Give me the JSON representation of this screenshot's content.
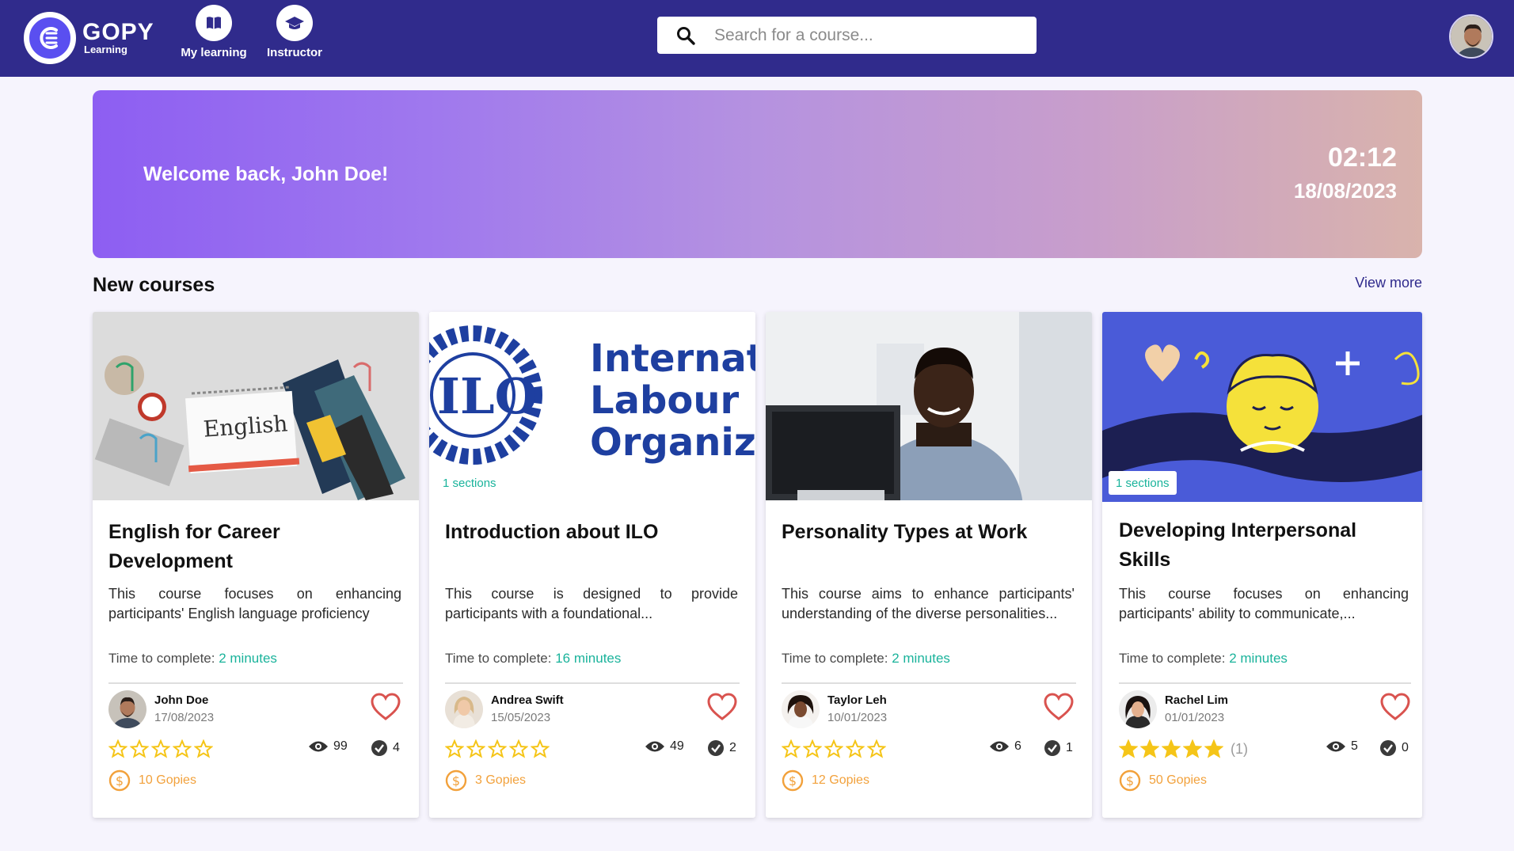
{
  "header": {
    "logo": {
      "brand": "GOPY",
      "sub": "Learning"
    },
    "nav": [
      {
        "label": "My learning",
        "icon": "book-icon"
      },
      {
        "label": "Instructor",
        "icon": "graduation-cap-icon"
      }
    ],
    "search": {
      "placeholder": "Search for a course...",
      "value": ""
    },
    "avatar": "user-avatar"
  },
  "banner": {
    "welcome": "Welcome back, John Doe!",
    "time": "02:12",
    "date": "18/08/2023"
  },
  "section": {
    "title": "New courses",
    "view_more": "View more"
  },
  "colors": {
    "topbar": "#302b8c",
    "accent_green": "#1ab39b",
    "star": "#f5c518",
    "heart": "#d9534f",
    "coin": "#f2a13b"
  },
  "courses": [
    {
      "title": "English for Career Development",
      "description": "This course focuses on enhancing participants' English language proficiency",
      "time_label": "Time to complete:",
      "time_value": "2 minutes",
      "author": "John Doe",
      "date": "17/08/2023",
      "rating": 0,
      "rating_count": "",
      "views": "99",
      "completions": "4",
      "price": "10 Gopies",
      "sections": ""
    },
    {
      "title": "Introduction about ILO",
      "description": "This course is designed to provide participants with a foundational...",
      "time_label": "Time to complete:",
      "time_value": "16 minutes",
      "author": "Andrea Swift",
      "date": "15/05/2023",
      "rating": 0,
      "rating_count": "",
      "views": "49",
      "completions": "2",
      "price": "3 Gopies",
      "sections": "1 sections",
      "thumb_text": [
        "Internatic",
        "Labour",
        "Organiza"
      ]
    },
    {
      "title": "Personality Types at Work",
      "description": "This course aims to enhance participants' understanding of the diverse personalities...",
      "time_label": "Time to complete:",
      "time_value": "2 minutes",
      "author": "Taylor Leh",
      "date": "10/01/2023",
      "rating": 0,
      "rating_count": "",
      "views": "6",
      "completions": "1",
      "price": "12 Gopies",
      "sections": ""
    },
    {
      "title": "Developing Interpersonal Skills",
      "description": "This course focuses on enhancing participants' ability to communicate,...",
      "time_label": "Time to complete:",
      "time_value": "2 minutes",
      "author": "Rachel Lim",
      "date": "01/01/2023",
      "rating": 5,
      "rating_count": "(1)",
      "views": "5",
      "completions": "0",
      "price": "50 Gopies",
      "sections": "1 sections"
    }
  ]
}
